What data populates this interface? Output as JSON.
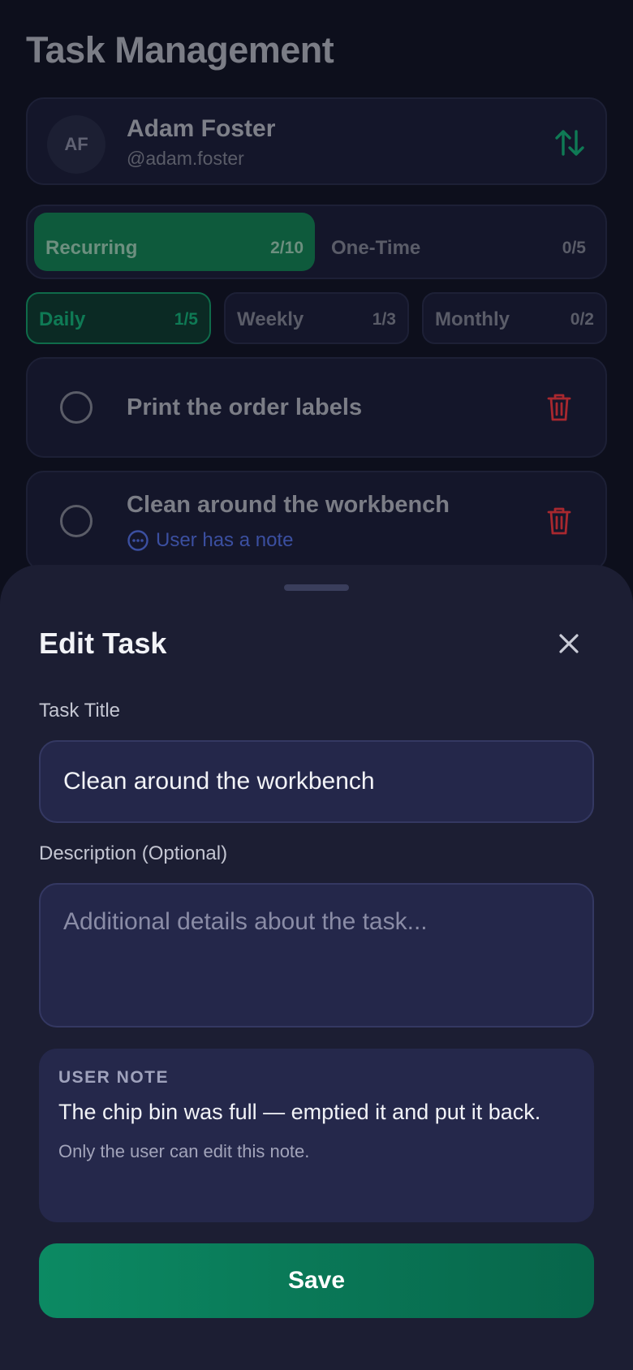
{
  "screen": {
    "title": "Task Management"
  },
  "user": {
    "initials": "AF",
    "name": "Adam Foster",
    "handle": "@adam.foster"
  },
  "task_type_toggle": {
    "options": [
      {
        "label": "Recurring",
        "count": "2/10",
        "active": true
      },
      {
        "label": "One-Time",
        "count": "0/5",
        "active": false
      }
    ]
  },
  "frequency_filter": {
    "options": [
      {
        "label": "Daily",
        "count": "1/5",
        "active": true
      },
      {
        "label": "Weekly",
        "count": "1/3",
        "active": false
      },
      {
        "label": "Monthly",
        "count": "0/2",
        "active": false
      }
    ]
  },
  "tasks": [
    {
      "title": "Print the order labels",
      "note_indicator": ""
    },
    {
      "title": "Clean around the workbench",
      "note_indicator": "User has a note"
    }
  ],
  "edit_sheet": {
    "title": "Edit Task",
    "task_title_label": "Task Title",
    "task_title_value": "Clean around the workbench",
    "description_label": "Description (Optional)",
    "description_placeholder": "Additional details about the task...",
    "user_note": {
      "heading": "USER NOTE",
      "text": "The chip bin was full — emptied it and put it back.",
      "footer": "Only the user can edit this note."
    },
    "save_label": "Save"
  },
  "colors": {
    "accent": "#0c8a63",
    "danger": "#a8282f",
    "note_link": "#3b4fa0"
  },
  "icons": {
    "sort": "sort-arrows-icon",
    "delete": "trash-icon",
    "note": "chat-bubble-icon",
    "close": "close-icon"
  }
}
